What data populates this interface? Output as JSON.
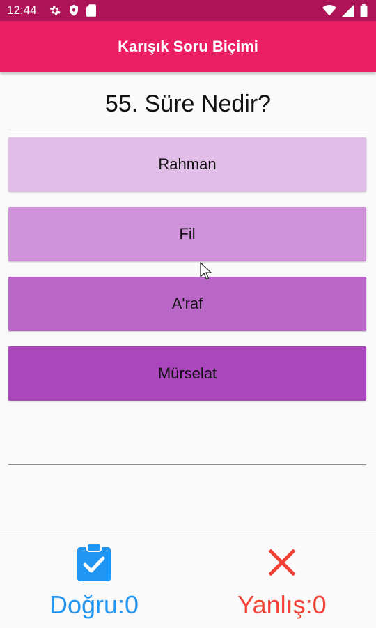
{
  "status_bar": {
    "time": "12:44",
    "left_icons": [
      "gear-icon",
      "shield-icon",
      "sd-card-icon"
    ],
    "right_icons": [
      "wifi-icon",
      "signal-icon",
      "battery-icon"
    ],
    "color": "#ad1457"
  },
  "app_bar": {
    "title": "Karışık Soru Biçimi",
    "color": "#e91e63"
  },
  "question": {
    "text": "55. Süre Nedir?"
  },
  "options": [
    {
      "label": "Rahman",
      "color": "#e1bee7"
    },
    {
      "label": "Fil",
      "color": "#ce93d8"
    },
    {
      "label": "A'raf",
      "color": "#ba68c8"
    },
    {
      "label": "Mürselat",
      "color": "#ab47bc"
    }
  ],
  "score": {
    "correct_label": "Doğru:0",
    "correct_color": "#2196f3",
    "wrong_label": "Yanlış:0",
    "wrong_color": "#f44336",
    "correct_icon": "clipboard-check-icon",
    "wrong_icon": "close-icon"
  }
}
